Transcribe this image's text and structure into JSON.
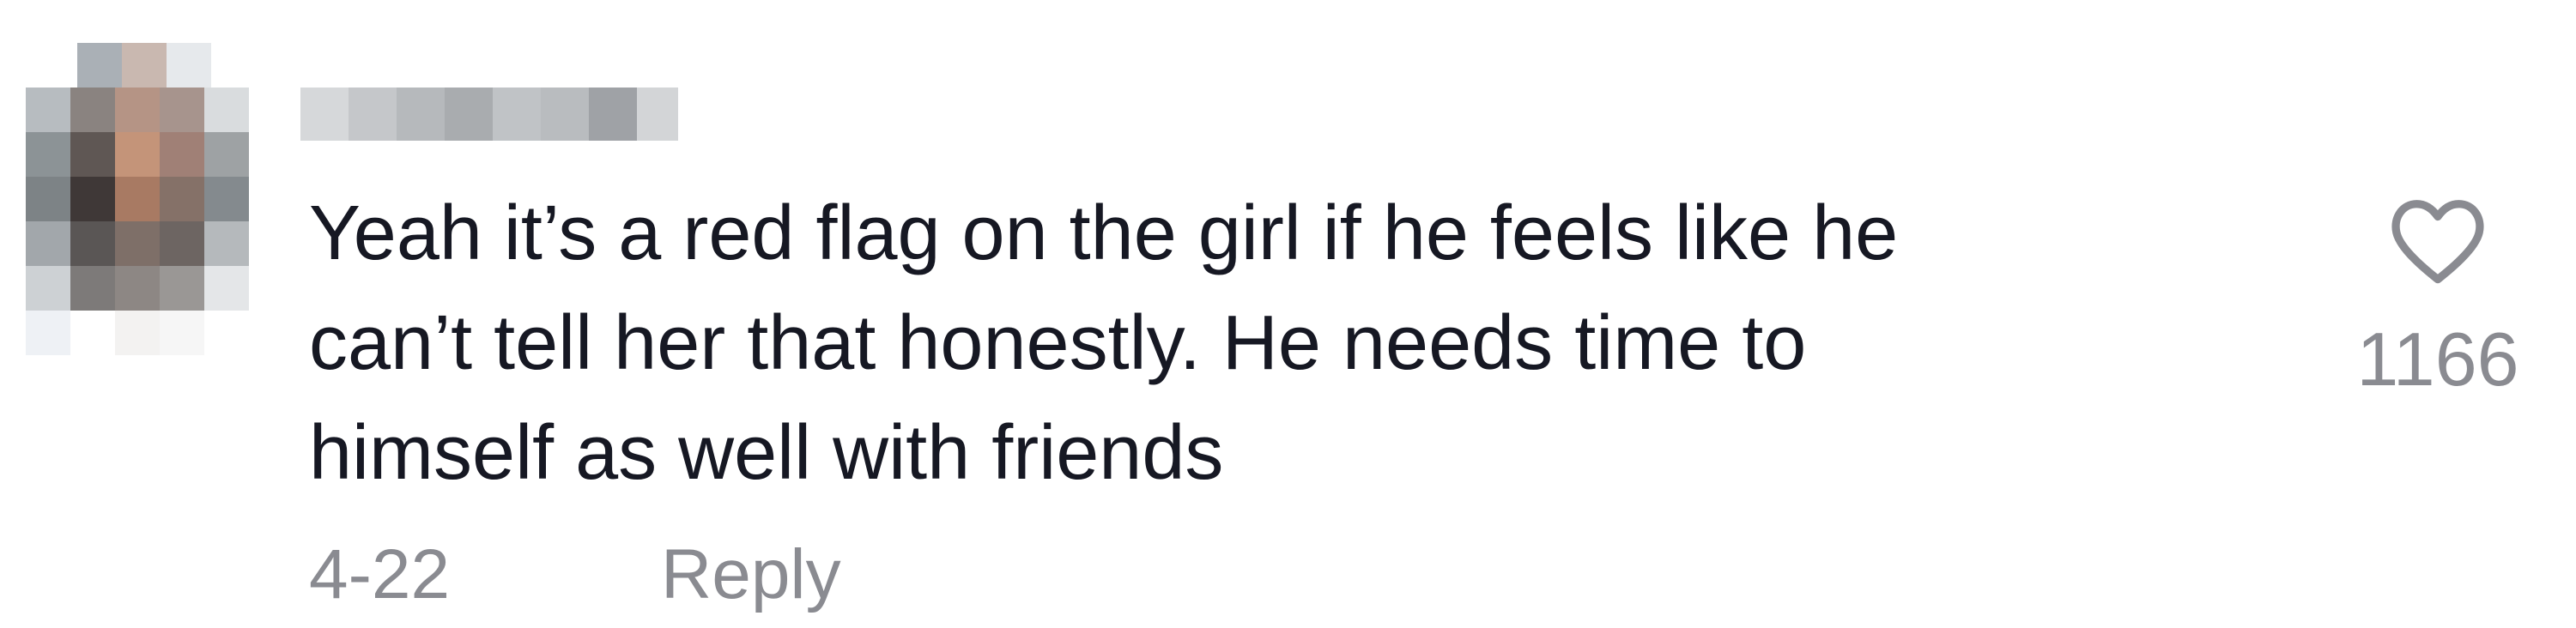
{
  "comment": {
    "text_lines": [
      "Yeah it’s a red flag on the girl if he feels like he",
      "can’t tell her that honestly. He needs time to",
      "himself as well with friends"
    ],
    "date": "4-22",
    "reply_label": "Reply",
    "like_count": "1166",
    "avatar_blurred": true,
    "username_blurred": true
  },
  "icons": {
    "like": "heart-outline-icon"
  },
  "colors": {
    "text": "#161823",
    "secondary": "#8a8b91"
  }
}
